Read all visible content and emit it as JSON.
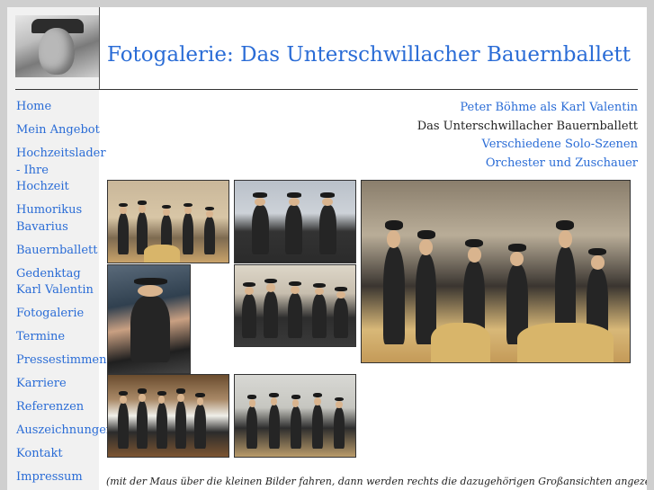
{
  "header": {
    "title": "Fotogalerie: Das Unterschwillacher Bauernballett"
  },
  "nav": {
    "items": [
      {
        "label": "Home"
      },
      {
        "label": "Mein Angebot"
      },
      {
        "label": "Hochzeitslader - Ihre Hochzeit"
      },
      {
        "label": "Humorikus Bavarius"
      },
      {
        "label": "Bauernballett"
      },
      {
        "label": "Gedenktag Karl Valentin"
      },
      {
        "label": "Fotogalerie"
      },
      {
        "label": "Termine"
      },
      {
        "label": "Pressestimmen"
      },
      {
        "label": "Karriere"
      },
      {
        "label": "Referenzen"
      },
      {
        "label": "Auszeichnungen"
      },
      {
        "label": "Kontakt"
      },
      {
        "label": "Impressum"
      }
    ]
  },
  "gallery_links": {
    "items": [
      {
        "label": "Peter Böhme als Karl Valentin",
        "current": false
      },
      {
        "label": "Das Unterschwillacher Bauernballett",
        "current": true
      },
      {
        "label": "Verschiedene Solo-Szenen",
        "current": false
      },
      {
        "label": "Orchester und Zuschauer",
        "current": false
      }
    ]
  },
  "caption": "(mit der Maus über die kleinen Bilder fahren, dann werden rechts die dazugehörigen Großansichten angezeigt."
}
